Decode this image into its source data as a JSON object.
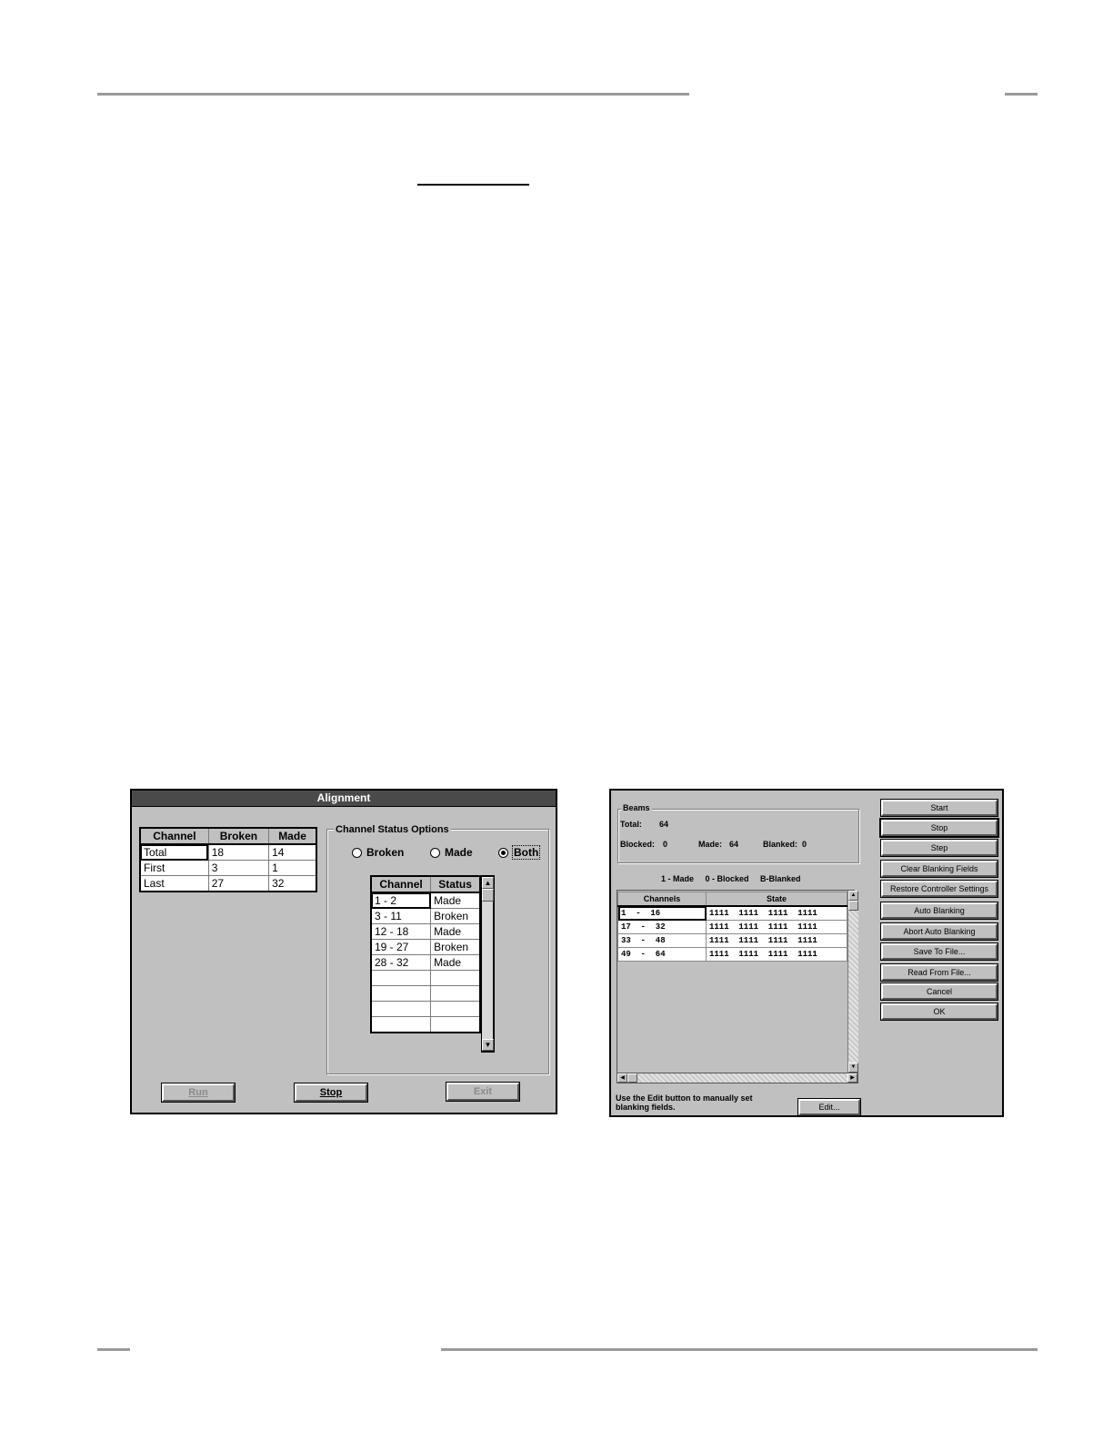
{
  "alignment": {
    "title": "Alignment",
    "summary_table": {
      "headers": [
        "Channel",
        "Broken",
        "Made"
      ],
      "rows": [
        [
          "Total",
          "18",
          "14"
        ],
        [
          "First",
          "3",
          "1"
        ],
        [
          "Last",
          "27",
          "32"
        ]
      ]
    },
    "options_group": {
      "label": "Channel Status Options",
      "radios": [
        {
          "label": "Broken",
          "selected": false
        },
        {
          "label": "Made",
          "selected": false
        },
        {
          "label": "Both",
          "selected": true
        }
      ]
    },
    "status_table": {
      "headers": [
        "Channel",
        "Status"
      ],
      "rows": [
        [
          "1 - 2",
          "Made"
        ],
        [
          "3 - 11",
          "Broken"
        ],
        [
          "12 - 18",
          "Made"
        ],
        [
          "19 - 27",
          "Broken"
        ],
        [
          "28 - 32",
          "Made"
        ],
        [
          "",
          ""
        ],
        [
          "",
          ""
        ],
        [
          "",
          ""
        ],
        [
          "",
          ""
        ]
      ]
    },
    "buttons": {
      "run": "Run",
      "stop": "Stop",
      "exit": "Exit"
    }
  },
  "blanking": {
    "beams_group_label": "Beams",
    "total_label": "Total:",
    "total_value": "64",
    "blocked_label": "Blocked:",
    "blocked_value": "0",
    "made_label": "Made:",
    "made_value": "64",
    "blanked_label": "Blanked:",
    "blanked_value": "0",
    "legend": "1 - Made     0 - Blocked     B-Blanked",
    "table": {
      "headers": [
        "Channels",
        "State"
      ],
      "rows": [
        [
          "1  -  16",
          "1111  1111  1111  1111"
        ],
        [
          "17  -  32",
          "1111  1111  1111  1111"
        ],
        [
          "33  -  48",
          "1111  1111  1111  1111"
        ],
        [
          "49  -  64",
          "1111  1111  1111  1111"
        ]
      ]
    },
    "buttons": [
      "Start",
      "Stop",
      "Step",
      "Clear Blanking Fields",
      "Restore Controller Settings",
      "Auto Blanking",
      "Abort Auto Blanking",
      "Save To File...",
      "Read From File...",
      "Cancel",
      "OK"
    ],
    "hint_line1": "Use the Edit button to manually set",
    "hint_line2": "blanking fields.",
    "edit_button": "Edit..."
  }
}
